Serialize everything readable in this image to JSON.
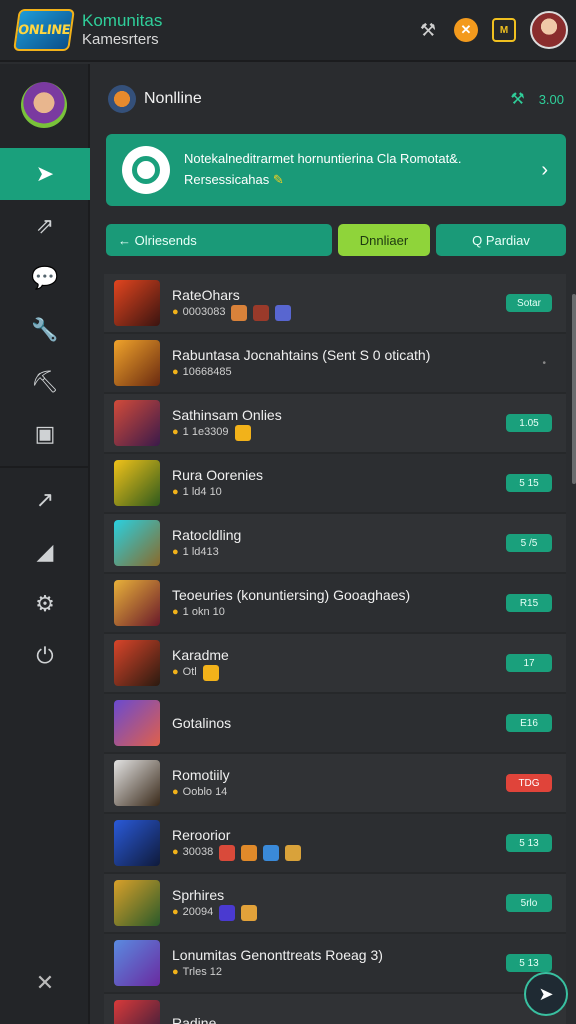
{
  "app": {
    "logo_text": "ONLINE",
    "brand_line1": "Komunitas",
    "brand_line2": "Kamesrters"
  },
  "top_icons": {
    "badge_text": "M"
  },
  "sidebar": {
    "items": [
      {
        "icon": "paper-plane-icon",
        "glyph": "➤"
      },
      {
        "icon": "chart-icon",
        "glyph": "⇗"
      },
      {
        "icon": "chat-bubble-icon",
        "glyph": "💬"
      },
      {
        "icon": "wrench-icon",
        "glyph": "🔧"
      },
      {
        "icon": "pickaxe-icon",
        "glyph": "⛏"
      },
      {
        "icon": "controller-icon",
        "glyph": "▣"
      },
      {
        "icon": "trend-icon",
        "glyph": "↗"
      },
      {
        "icon": "flag-icon",
        "glyph": "◢"
      },
      {
        "icon": "gear-icon",
        "glyph": "⚙"
      },
      {
        "icon": "power-icon",
        "glyph": "⏻"
      }
    ],
    "bottom_icon": "✕"
  },
  "header": {
    "title": "Nonlline",
    "right_value": "3.00"
  },
  "banner": {
    "line1": "Notekalneditrarmet hornuntierina Cla Romotat&.",
    "line2": "Rersessicahas"
  },
  "buttons": {
    "left": "← Olriesends",
    "middle": "Dnnliaer",
    "right": "Q Pardiav"
  },
  "rows": [
    {
      "title": "RateOhars",
      "sub": "0003083",
      "badge": "Sotar",
      "thumb": [
        "#e2451f",
        "#3a1410"
      ],
      "minis": [
        "#d9823a",
        "#9a3a2a",
        "#5866d0"
      ]
    },
    {
      "title": "Rabuntasa Jocnahtains (Sent S 0 oticath)",
      "sub": "10668485",
      "badge": "•",
      "badge_style": "dot",
      "thumb": [
        "#f0a32b",
        "#6a2a10"
      ],
      "minis": []
    },
    {
      "title": "Sathinsam Onlies",
      "sub": "1 1e3309",
      "badge": "1.05",
      "thumb": [
        "#d24b3a",
        "#3a1a4a"
      ],
      "minis": [
        "#f2b21a"
      ]
    },
    {
      "title": "Rura Oorenies",
      "sub": "1 ld4 10",
      "badge": "5 15",
      "thumb": [
        "#f1c21a",
        "#2f5a1c"
      ],
      "minis": []
    },
    {
      "title": "Ratocldling",
      "sub": "1 ld413",
      "badge": "5 /5",
      "thumb": [
        "#2ad0e0",
        "#8a6a2a"
      ],
      "minis": []
    },
    {
      "title": "Teoeuries (konuntiersing) Gooaghaes)",
      "sub": "1 okn 10",
      "badge": "R15",
      "thumb": [
        "#e8b13a",
        "#6a1a2a"
      ],
      "minis": []
    },
    {
      "title": "Karadme",
      "sub": "Otl",
      "badge": "17",
      "thumb": [
        "#d9452a",
        "#2a1a10"
      ],
      "minis": [
        "#f2b21a"
      ]
    },
    {
      "title": "Gotalinos",
      "sub": "",
      "badge": "E16",
      "thumb": [
        "#6a4ad0",
        "#e0604a"
      ],
      "minis": []
    },
    {
      "title": "Romotiily",
      "sub": "Ooblo 14",
      "badge": "TDG",
      "badge_style": "red",
      "thumb": [
        "#e2e2e2",
        "#3a2a1a"
      ],
      "minis": []
    },
    {
      "title": "Reroorior",
      "sub": "30038",
      "badge": "5 13",
      "thumb": [
        "#2a5ad9",
        "#0f1a3a"
      ],
      "minis": [
        "#d94a3a",
        "#e08a2a",
        "#3a8ad9",
        "#d9a23a"
      ]
    },
    {
      "title": "Sprhires",
      "sub": "20094",
      "badge": "5rlo",
      "thumb": [
        "#d9a02a",
        "#2a5a2a"
      ],
      "minis": [
        "#4a3ad0",
        "#e2a23a"
      ]
    },
    {
      "title": "Lonumitas Genonttreats Roeag 3)",
      "sub": "Trles 12",
      "badge": "5 13",
      "thumb": [
        "#5a8ae0",
        "#6a2aa0"
      ],
      "minis": []
    },
    {
      "title": "Radine",
      "sub": "",
      "badge": "",
      "thumb": [
        "#d93a3a",
        "#2a1a3a"
      ],
      "minis": []
    }
  ]
}
